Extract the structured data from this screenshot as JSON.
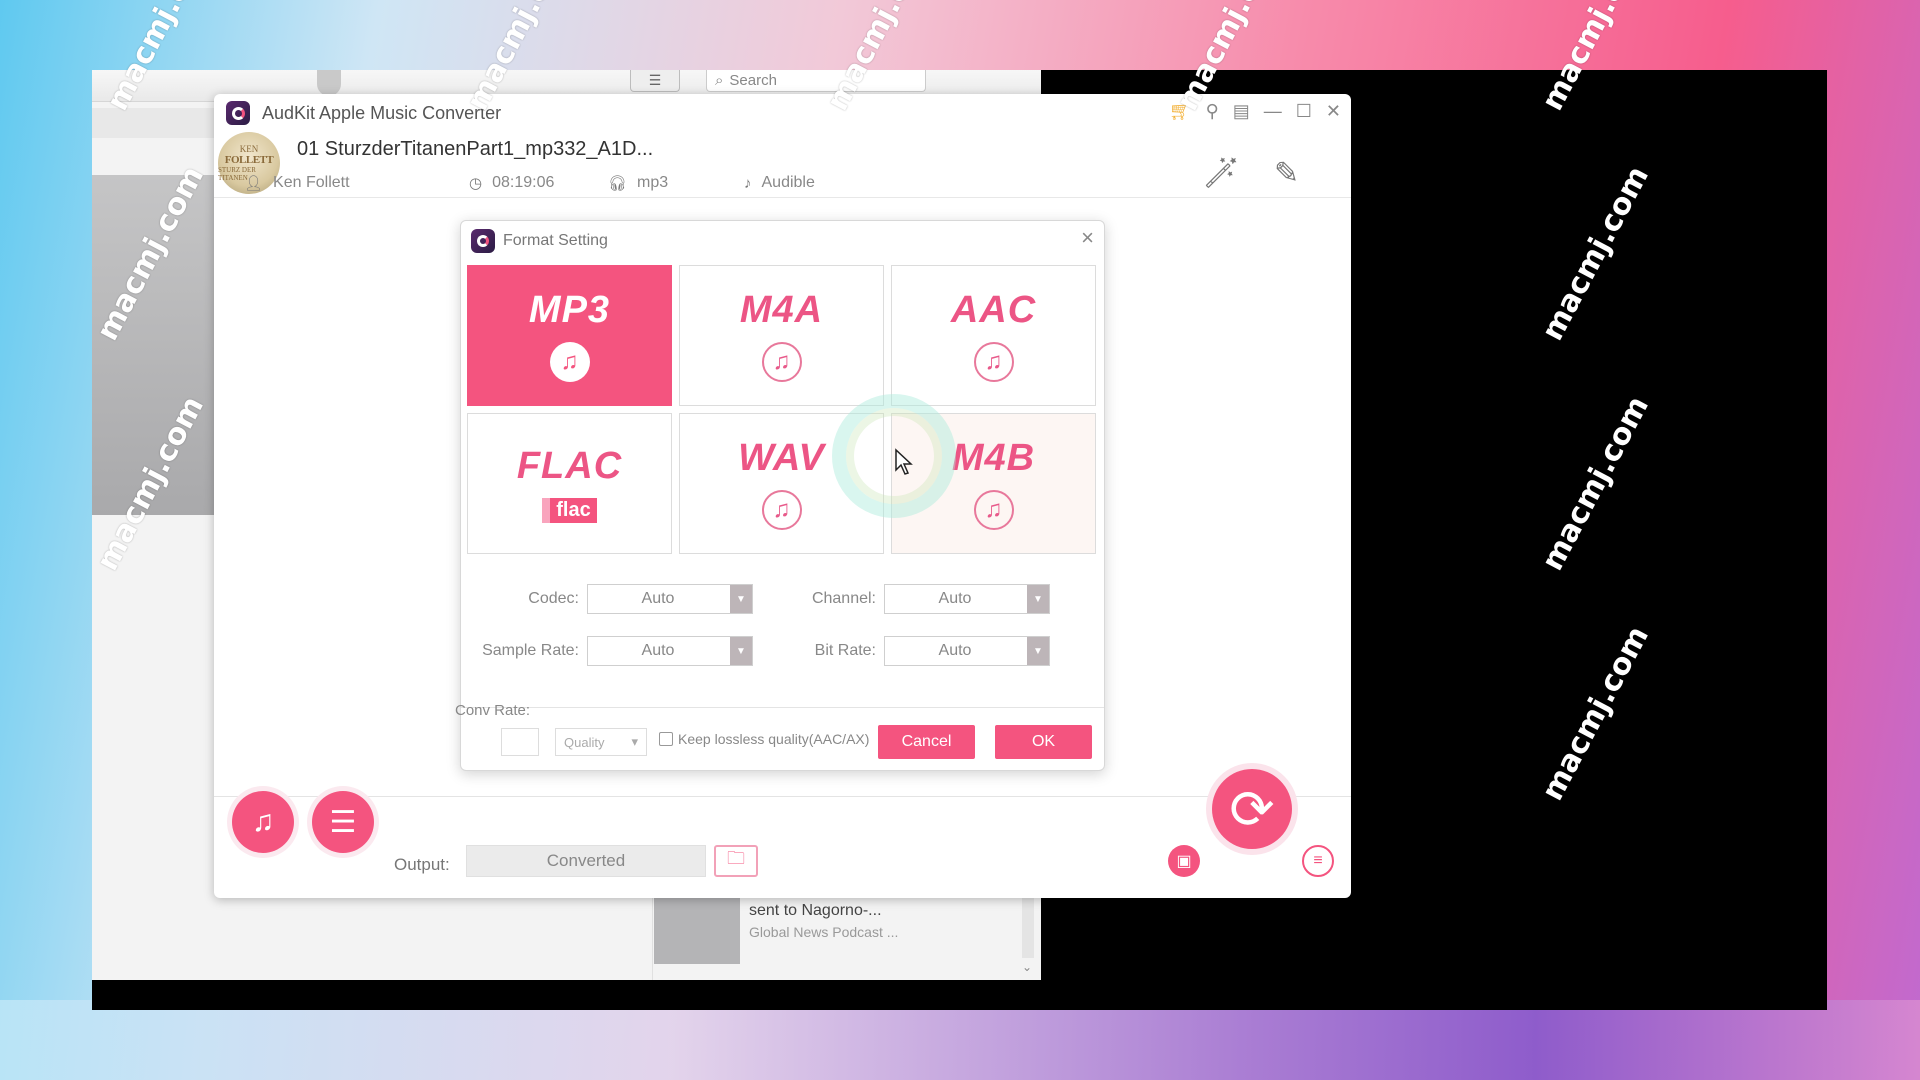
{
  "background_app": {
    "search_placeholder": "Search",
    "list_view_icon": "list-icon",
    "podcast": {
      "title": "sent to Nagorno-...",
      "subtitle": "Global News Podcast ..."
    }
  },
  "app": {
    "title": "AudKit Apple Music Converter",
    "window_controls": [
      "cart-icon",
      "search-icon",
      "menu-icon",
      "minimize-icon",
      "maximize-icon",
      "close-icon"
    ]
  },
  "track": {
    "cover_text": [
      "KEN",
      "FOLLETT",
      "STURZ DER TITANEN"
    ],
    "title": "01 SturzderTitanenPart1_mp332_A1D...",
    "author": "Ken Follett",
    "duration": "08:19:06",
    "format": "mp3",
    "source": "Audible"
  },
  "dialog": {
    "title": "Format Setting",
    "formats": [
      {
        "label": "MP3",
        "selected": true,
        "icon": "music-note-icon"
      },
      {
        "label": "M4A",
        "selected": false,
        "icon": "music-note-icon"
      },
      {
        "label": "AAC",
        "selected": false,
        "icon": "music-note-icon"
      },
      {
        "label": "FLAC",
        "selected": false,
        "icon": "flac-badge-icon",
        "badge": "flac"
      },
      {
        "label": "WAV",
        "selected": false,
        "icon": "music-note-icon"
      },
      {
        "label": "M4B",
        "selected": false,
        "icon": "music-note-icon"
      }
    ],
    "fields": {
      "codec": {
        "label": "Codec:",
        "value": "Auto"
      },
      "channel": {
        "label": "Channel:",
        "value": "Auto"
      },
      "sample_rate": {
        "label": "Sample Rate:",
        "value": "Auto"
      },
      "bit_rate": {
        "label": "Bit Rate:",
        "value": "Auto"
      }
    },
    "conversion_rate_label": "Conv Rate:",
    "quality_select": "Quality",
    "keep_lossless_label": "Keep lossless quality(AAC/AX)",
    "keep_lossless_checked": false,
    "cancel_label": "Cancel",
    "ok_label": "OK"
  },
  "bottom": {
    "output_label": "Output:",
    "output_value": "Converted"
  },
  "watermark": "macmj.com",
  "colors": {
    "accent": "#f4547f",
    "frame": "#000000"
  }
}
